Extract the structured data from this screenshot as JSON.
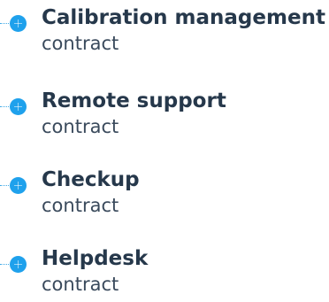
{
  "items": [
    {
      "title": "Calibration management",
      "subtitle": "contract",
      "icon": "plus-icon"
    },
    {
      "title": "Remote support",
      "subtitle": "contract",
      "icon": "plus-icon"
    },
    {
      "title": "Checkup",
      "subtitle": "contract",
      "icon": "plus-icon"
    },
    {
      "title": "Helpdesk",
      "subtitle": "contract",
      "icon": "plus-icon"
    }
  ],
  "colors": {
    "accent": "#1fa1ec",
    "title_text": "#26384b",
    "subtitle_text": "#3a4a5c"
  }
}
